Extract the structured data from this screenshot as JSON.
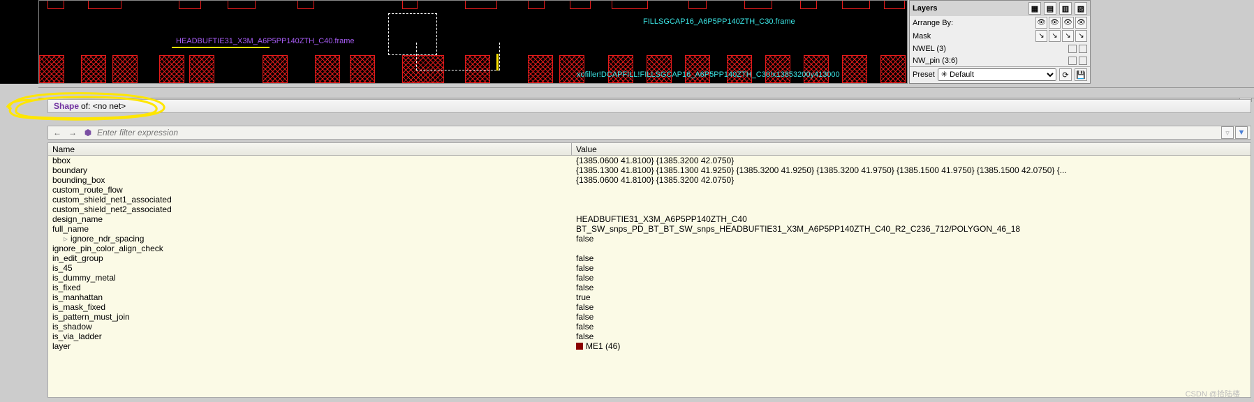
{
  "canvas": {
    "labels": {
      "purple": "HEADBUFTIE31_X3M_A6P5PP140ZTH_C40.frame",
      "cyan_top": "FILLSGCAP16_A6P5PP140ZTH_C30.frame",
      "cyan_bottom": "xofiller!DCAPFILL!FILLSGCAP16_A6P5PP140ZTH_C30!x13853200y413000"
    }
  },
  "layers_panel": {
    "title": "Layers",
    "arrange_label": "Arrange By:",
    "mask_label": "Mask",
    "rows": [
      {
        "name": "NWEL (3)"
      },
      {
        "name": "NW_pin (3:6)"
      }
    ],
    "preset_label": "Preset",
    "preset_value": "✳ Default"
  },
  "shape_header": {
    "prefix": "Shape",
    "middle": "of:",
    "net": "<no net>"
  },
  "filter": {
    "placeholder": "Enter filter expression"
  },
  "table": {
    "col_name": "Name",
    "col_value": "Value",
    "rows": [
      {
        "name": "bbox",
        "value": "{1385.0600 41.8100} {1385.3200 42.0750}"
      },
      {
        "name": "boundary",
        "value": "{1385.1300 41.8100} {1385.1300 41.9250} {1385.3200 41.9250} {1385.3200 41.9750} {1385.1500 41.9750} {1385.1500 42.0750} {..."
      },
      {
        "name": "bounding_box",
        "value": "{1385.0600 41.8100} {1385.3200 42.0750}"
      },
      {
        "name": "custom_route_flow",
        "value": ""
      },
      {
        "name": "custom_shield_net1_associated",
        "value": ""
      },
      {
        "name": "custom_shield_net2_associated",
        "value": ""
      },
      {
        "name": "design_name",
        "value": "HEADBUFTIE31_X3M_A6P5PP140ZTH_C40"
      },
      {
        "name": "full_name",
        "value": "BT_SW_snps_PD_BT_BT_SW_snps_HEADBUFTIE31_X3M_A6P5PP140ZTH_C40_R2_C236_712/POLYGON_46_18"
      },
      {
        "name": "ignore_ndr_spacing",
        "value": "false",
        "indent": true,
        "arrow": true
      },
      {
        "name": "ignore_pin_color_align_check",
        "value": ""
      },
      {
        "name": "in_edit_group",
        "value": "false"
      },
      {
        "name": "is_45",
        "value": "false"
      },
      {
        "name": "is_dummy_metal",
        "value": "false"
      },
      {
        "name": "is_fixed",
        "value": "false"
      },
      {
        "name": "is_manhattan",
        "value": "true"
      },
      {
        "name": "is_mask_fixed",
        "value": "false"
      },
      {
        "name": "is_pattern_must_join",
        "value": "false"
      },
      {
        "name": "is_shadow",
        "value": "false"
      },
      {
        "name": "is_via_ladder",
        "value": "false"
      },
      {
        "name": "layer",
        "value": "ME1 (46)",
        "swatch": true
      }
    ]
  },
  "watermark": "CSDN @拾陆楼"
}
